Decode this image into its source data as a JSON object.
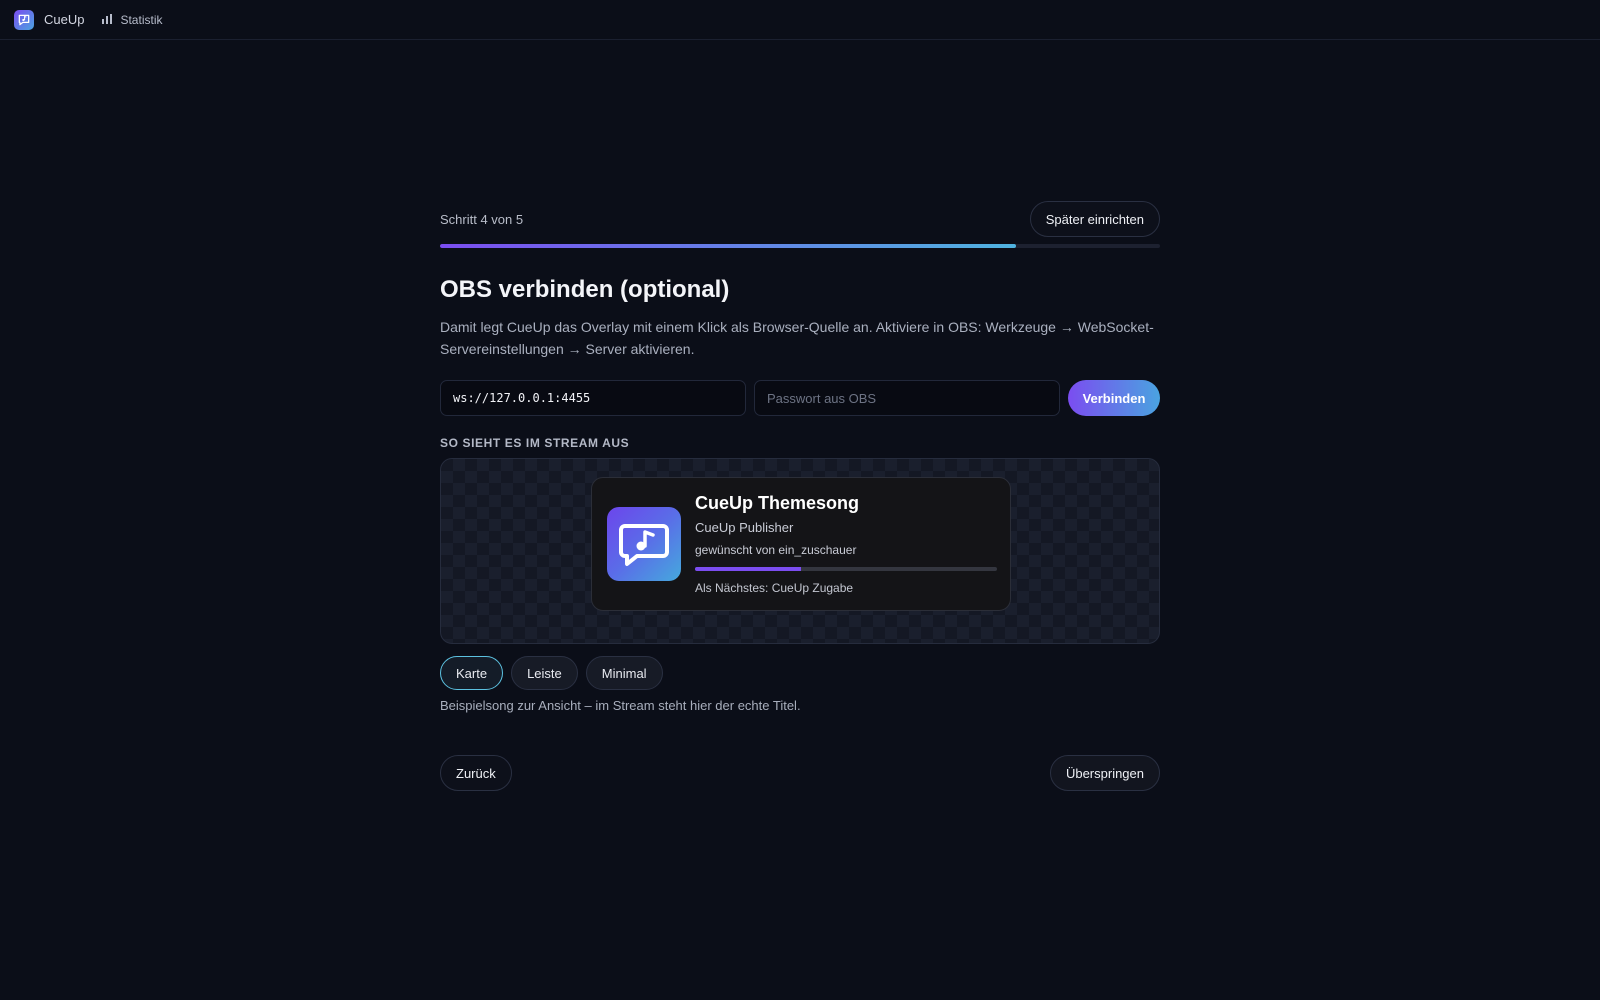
{
  "topbar": {
    "brand": "CueUp",
    "nav_stats": "Statistik"
  },
  "wizard": {
    "step_text": "Schritt 4 von 5",
    "later_button": "Später einrichten",
    "progress": 0.8,
    "title": "OBS verbinden (optional)",
    "description": "Damit legt CueUp das Overlay mit einem Klick als Browser-Quelle an. Aktiviere in OBS: Werkzeuge → WebSocket-Servereinstellungen → Server aktivieren.",
    "url_value": "ws://127.0.0.1:4455",
    "password_placeholder": "Passwort aus OBS",
    "connect_button": "Verbinden",
    "preview_label": "SO SIEHT ES IM STREAM AUS",
    "card": {
      "title": "CueUp Themesong",
      "artist": "CueUp Publisher",
      "requested_by": "gewünscht von ein_zuschauer",
      "progress": 0.35,
      "next": "Als Nächstes: CueUp Zugabe"
    },
    "styles": [
      "Karte",
      "Leiste",
      "Minimal"
    ],
    "active_style": "Karte",
    "hint": "Beispielsong zur Ansicht – im Stream steht hier der echte Titel.",
    "back_button": "Zurück",
    "skip_button": "Überspringen"
  },
  "colors": {
    "background": "#0b0e18",
    "accent_start": "#7b4df0",
    "accent_end": "#4aa3e0"
  },
  "icons": {
    "brand": "chat-music-icon",
    "stats": "bar-chart-icon",
    "card_art": "chat-music-icon"
  }
}
